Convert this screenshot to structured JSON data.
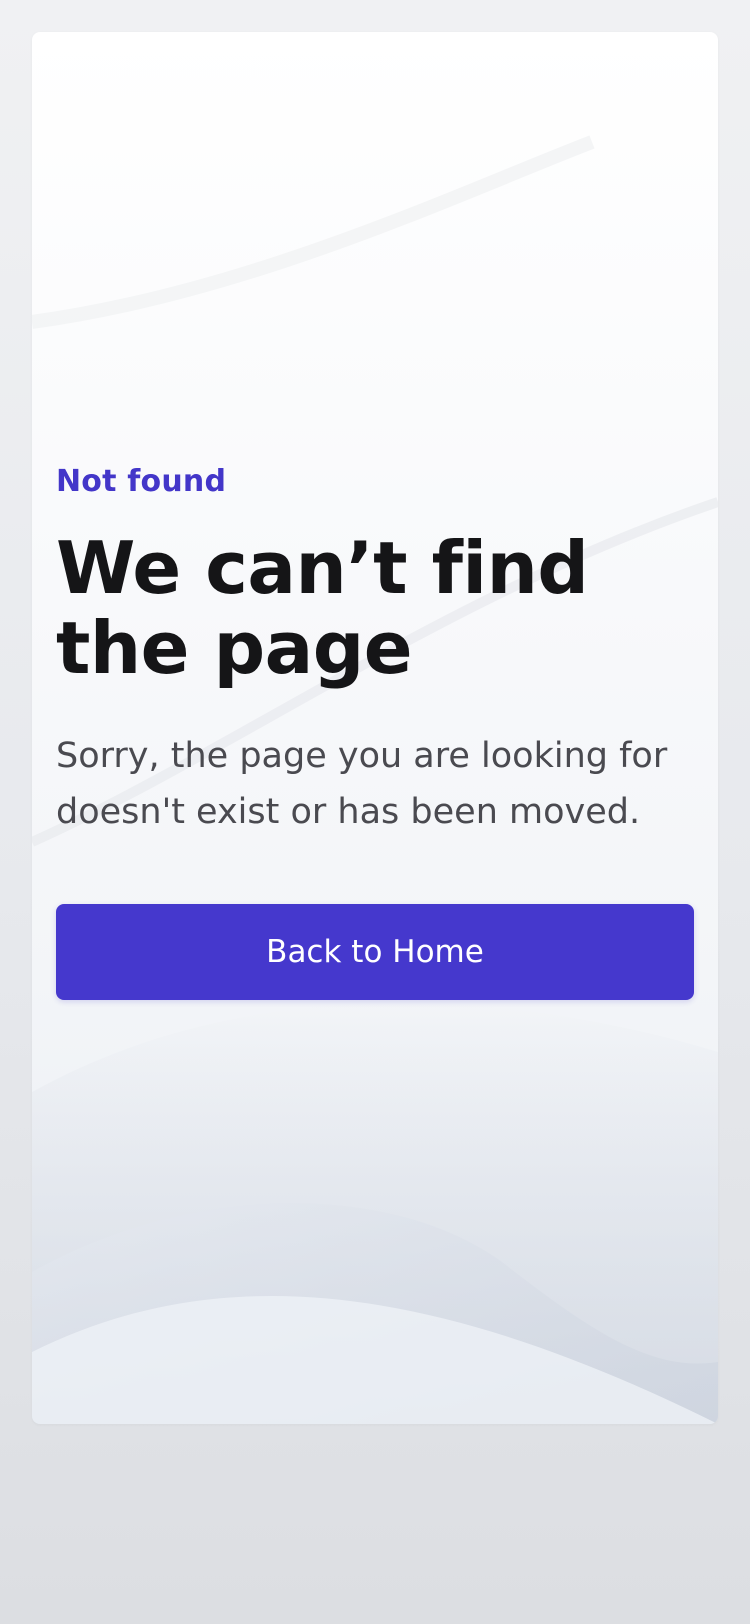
{
  "error_page": {
    "eyebrow": "Not found",
    "title": "We can’t find the page",
    "description": "Sorry, the page you are looking for doesn't exist or has been moved.",
    "home_button_label": "Back to Home"
  },
  "colors": {
    "accent": "#4538cd",
    "eyebrow": "#4336c9",
    "title": "#151517",
    "description": "#4a4a50",
    "page_background": "#e7e9ed",
    "card_background": "#ffffff"
  }
}
